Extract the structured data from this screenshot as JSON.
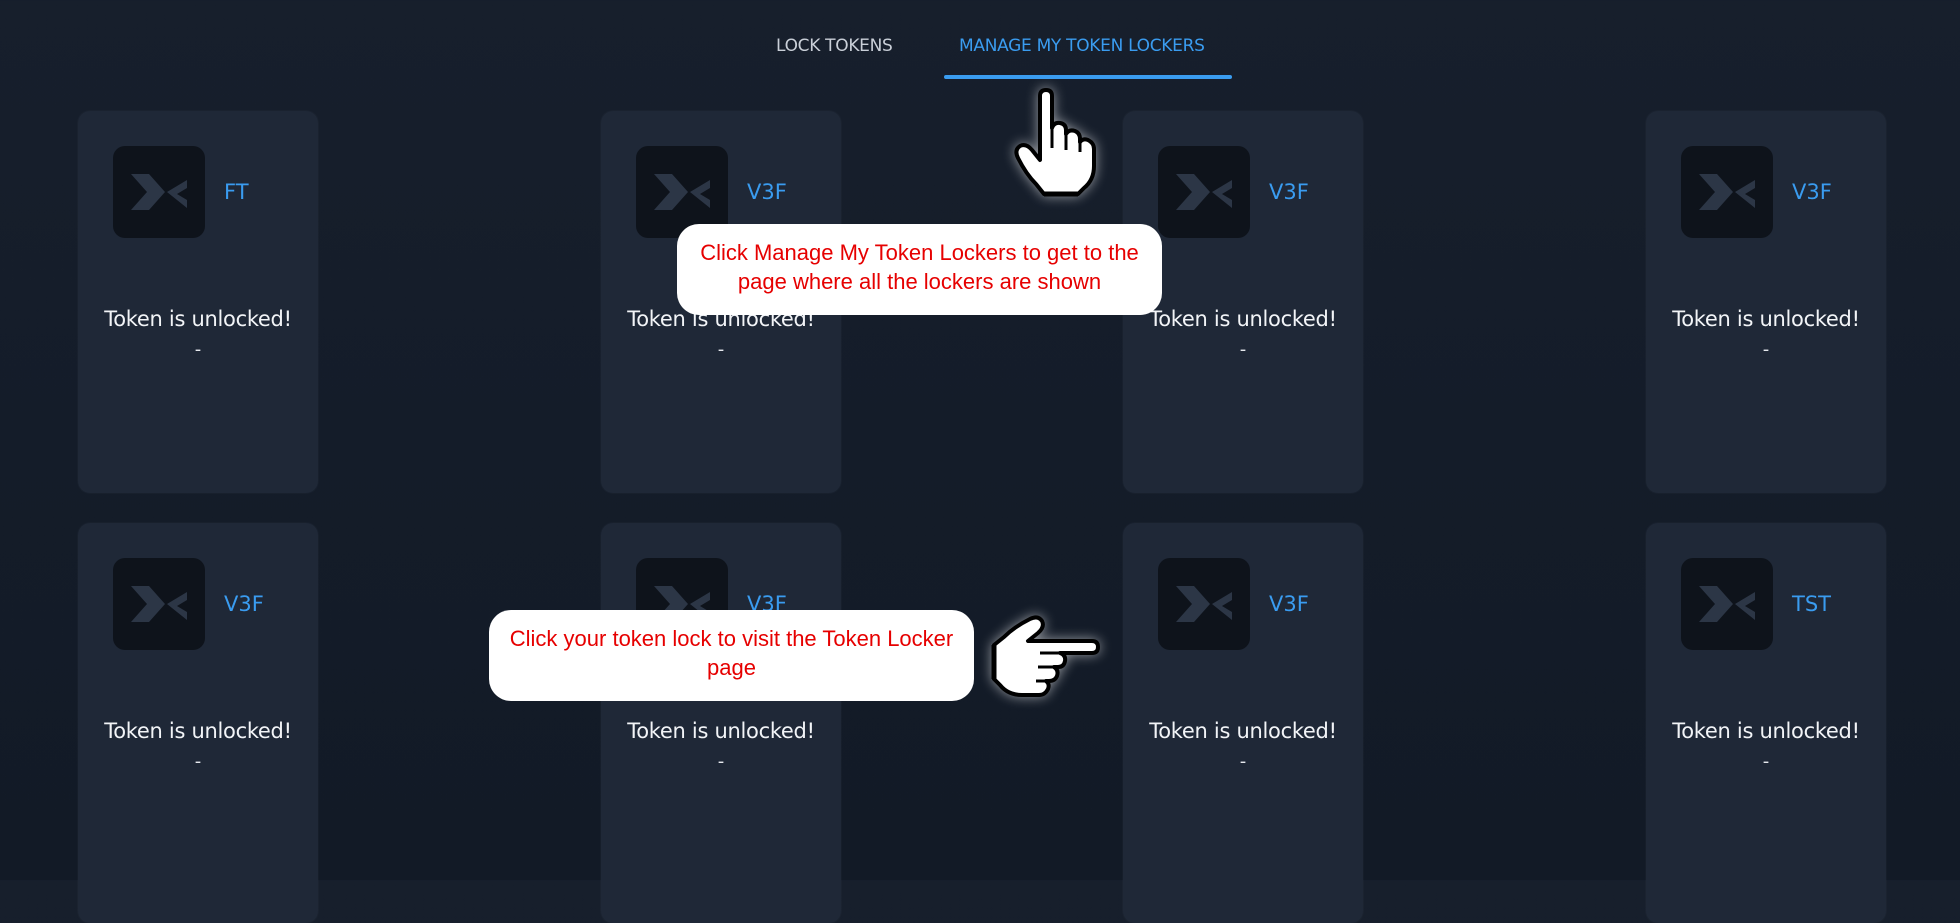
{
  "tabs": {
    "lock_tokens": "LOCK TOKENS",
    "manage_lockers": "MANAGE MY TOKEN LOCKERS",
    "active": "manage_lockers"
  },
  "cards": [
    {
      "symbol": "FT",
      "status": "Token is unlocked!",
      "detail": "-"
    },
    {
      "symbol": "V3F",
      "status": "Token is unlocked!",
      "detail": "-"
    },
    {
      "symbol": "V3F",
      "status": "Token is unlocked!",
      "detail": "-"
    },
    {
      "symbol": "V3F",
      "status": "Token is unlocked!",
      "detail": "-"
    },
    {
      "symbol": "V3F",
      "status": "Token is unlocked!",
      "detail": "-"
    },
    {
      "symbol": "V3F",
      "status": "Token is unlocked!",
      "detail": "-"
    },
    {
      "symbol": "V3F",
      "status": "Token is unlocked!",
      "detail": "-"
    },
    {
      "symbol": "TST",
      "status": "Token is unlocked!",
      "detail": "-"
    }
  ],
  "callouts": {
    "manage_hint": "Click Manage My Token Lockers to get to the page where all the lockers are shown",
    "card_hint": "Click your token lock to visit the Token Locker page"
  },
  "icons": {
    "token_logo": "token-logo-icon",
    "pointer_up": "hand-pointer-up-icon",
    "pointer_right": "hand-pointer-right-icon"
  },
  "colors": {
    "accent": "#3a9cf0",
    "background": "#141c29",
    "card": "#1f2837",
    "callout_text": "#e60000"
  }
}
